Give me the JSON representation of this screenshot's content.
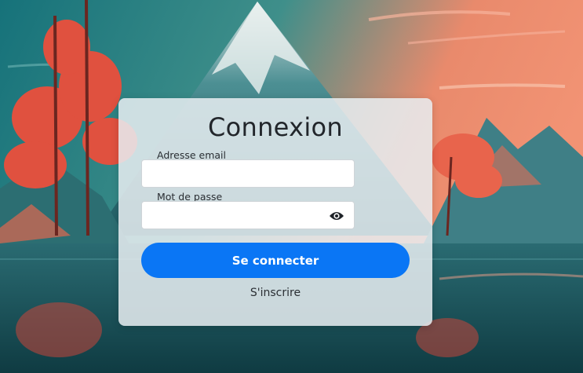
{
  "login": {
    "title": "Connexion",
    "email_label": "Adresse email",
    "email_value": "",
    "password_label": "Mot de passe",
    "password_value": "",
    "submit_label": "Se connecter",
    "signup_label": "S'inscrire",
    "accent_color": "#0a76f5"
  },
  "icons": {
    "password_toggle": "eye-icon"
  }
}
